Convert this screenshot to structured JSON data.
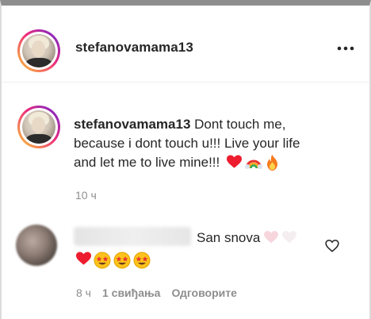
{
  "post": {
    "username": "stefanovamama13",
    "more_icon": "more-horizontal-icon"
  },
  "caption": {
    "username": "stefanovamama13",
    "text_line1": "Dont touch me,",
    "text_line2": "because i dont touch u!!! Live your life",
    "text_line3": "and let me to live mine!!!",
    "emojis": [
      "red-heart-emoji",
      "rainbow-emoji",
      "fire-emoji"
    ],
    "time": "10 ч"
  },
  "reply": {
    "text": "San snova",
    "emojis": [
      "red-heart-emoji",
      "star-struck-emoji",
      "star-struck-emoji",
      "star-struck-emoji"
    ],
    "time": "8 ч",
    "likes": "1 свиђања",
    "reply_label": "Одговорите"
  },
  "colors": {
    "text": "#262626",
    "muted": "#8e8e8e",
    "heart": "#ed1c2e"
  }
}
